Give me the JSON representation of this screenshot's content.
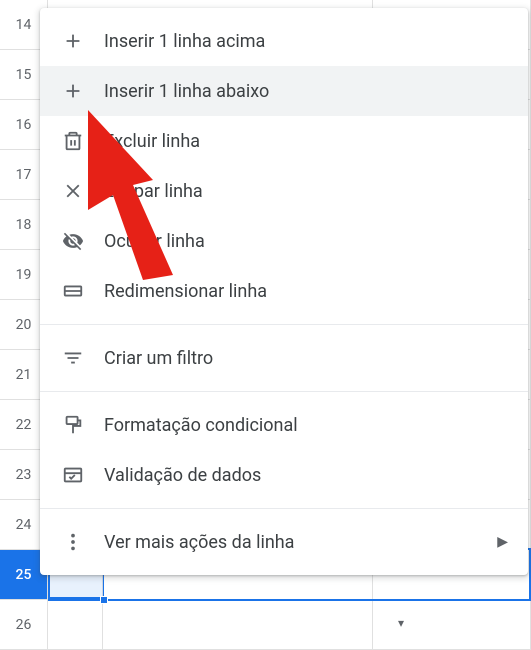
{
  "rows": [
    "14",
    "15",
    "16",
    "17",
    "18",
    "19",
    "20",
    "21",
    "22",
    "23",
    "24",
    "25",
    "26"
  ],
  "selected_row_index": 11,
  "menu": {
    "items": [
      {
        "label": "Inserir 1 linha acima",
        "icon": "plus-icon"
      },
      {
        "label": "Inserir 1 linha abaixo",
        "icon": "plus-icon",
        "hovered": true
      },
      {
        "label": "Excluir linha",
        "icon": "trash-icon"
      },
      {
        "label": "Limpar linha",
        "icon": "x-icon"
      },
      {
        "label": "Ocultar linha",
        "icon": "eye-off-icon"
      },
      {
        "label": "Redimensionar linha",
        "icon": "resize-icon"
      }
    ],
    "group2": [
      {
        "label": "Criar um filtro",
        "icon": "filter-icon"
      }
    ],
    "group3": [
      {
        "label": "Formatação condicional",
        "icon": "paint-icon"
      },
      {
        "label": "Validação de dados",
        "icon": "validation-icon"
      }
    ],
    "group4": [
      {
        "label": "Ver mais ações da linha",
        "icon": "more-icon",
        "submenu": true
      }
    ]
  }
}
